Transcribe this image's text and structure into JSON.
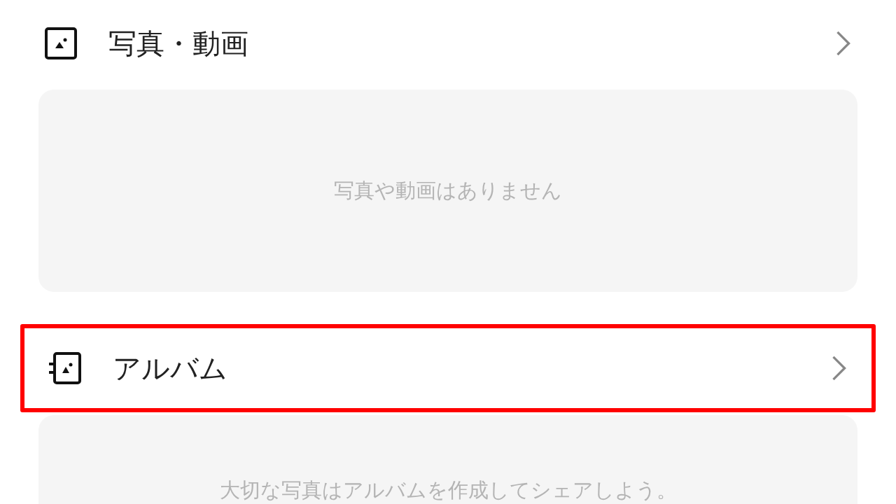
{
  "sections": [
    {
      "title": "写真・動画",
      "kind": "photo",
      "highlighted": false,
      "empty_message": "写真や動画はありません"
    },
    {
      "title": "アルバム",
      "kind": "album",
      "highlighted": true,
      "empty_message": "大切な写真はアルバムを作成してシェアしよう。"
    }
  ]
}
